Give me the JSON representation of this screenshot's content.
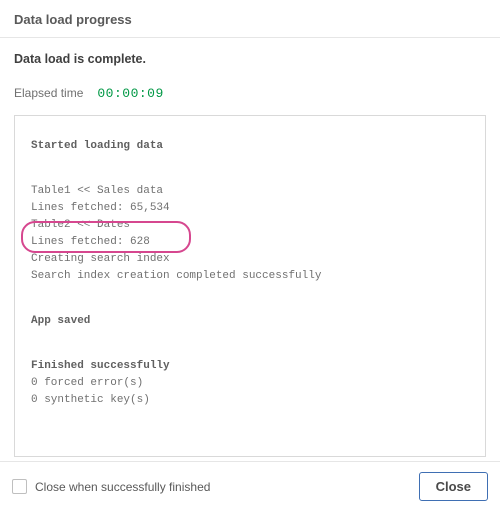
{
  "header": {
    "title": "Data load progress"
  },
  "status": {
    "text": "Data load is complete."
  },
  "elapsed": {
    "label": "Elapsed time",
    "value": "00:00:09"
  },
  "log": {
    "started": "Started loading data",
    "lines": [
      "Table1 << Sales data",
      "Lines fetched: 65,534",
      "Table2 << Dates",
      "Lines fetched: 628",
      "Creating search index",
      "Search index creation completed successfully"
    ],
    "app_saved": "App saved",
    "finished_heading": "Finished successfully",
    "finished_lines": [
      "0 forced error(s)",
      "0 synthetic key(s)"
    ]
  },
  "footer": {
    "checkbox_label": "Close when successfully finished",
    "close_label": "Close"
  },
  "colors": {
    "accent_green": "#009845",
    "highlight": "#d6478f",
    "button_border": "#3f6fb3"
  }
}
